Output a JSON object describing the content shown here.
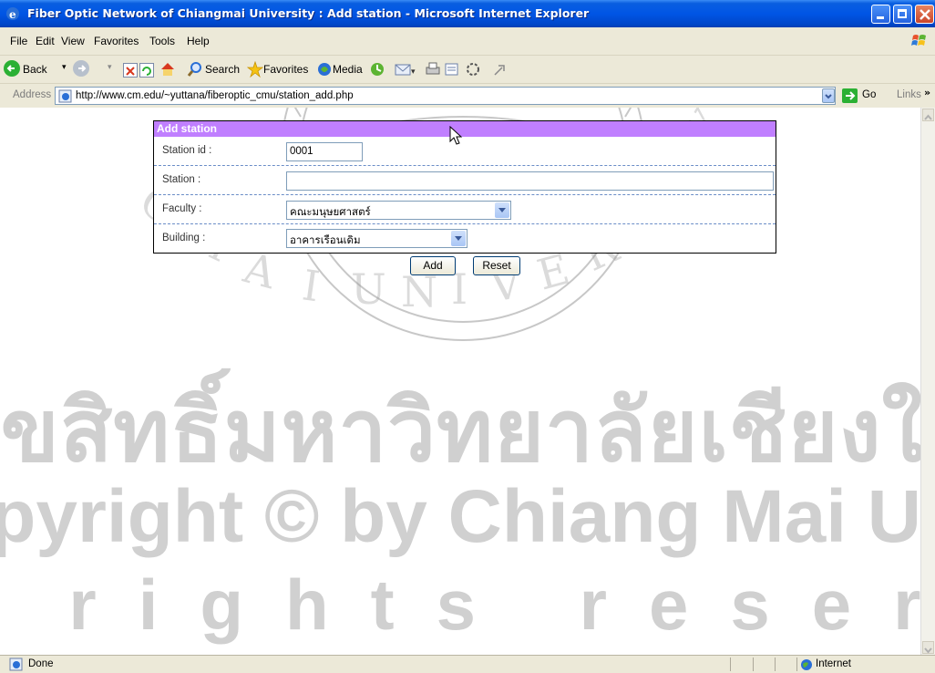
{
  "window": {
    "title": "Fiber Optic Network of Chiangmai University : Add station - Microsoft Internet Explorer"
  },
  "menubar": {
    "items": [
      "File",
      "Edit",
      "View",
      "Favorites",
      "Tools",
      "Help"
    ]
  },
  "toolbar": {
    "back_label": "Back",
    "search_label": "Search",
    "favorites_label": "Favorites",
    "media_label": "Media"
  },
  "addressbar": {
    "label": "Address",
    "url": "http://www.cm.edu/~yuttana/fiberoptic_cmu/station_add.php",
    "go_label": "Go",
    "links_label": "Links"
  },
  "form": {
    "header": "Add station",
    "fields": [
      {
        "label": "Station id :",
        "value": ""
      },
      {
        "label": "Station :",
        "value": ""
      },
      {
        "label": "Faculty :",
        "value": "คณะมนุษยศาสตร์"
      },
      {
        "label": "Building :",
        "value": "อาคารเรือนเดิม"
      }
    ],
    "station_id_value": "0001",
    "station_value": "",
    "add_label": "Add",
    "reset_label": "Reset"
  },
  "watermark": {
    "line1": "ลิขสิทธิ์มหาวิทยาลัยเชียงใหม่",
    "line2": "Copyright © by Chiang Mai University",
    "line3": "All rights reserved"
  },
  "statusbar": {
    "text": "Done",
    "zone": "Internet"
  },
  "colors": {
    "titlebar": "#0055e5",
    "form_header": "#c07fff",
    "row_separator": "#6a8dc7"
  }
}
